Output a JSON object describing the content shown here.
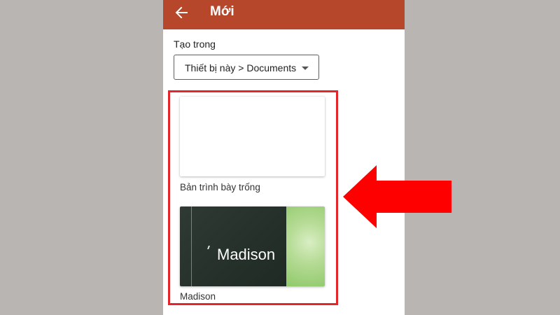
{
  "appbar": {
    "title": "Mới",
    "back_icon": "arrow-left-icon",
    "color": "#b7472a"
  },
  "create_in": {
    "label": "Tạo trong",
    "location_value": "Thiết bị này > Documents"
  },
  "templates": [
    {
      "name": "Bản trình bày trống",
      "thumbnail_title": ""
    },
    {
      "name": "Madison",
      "thumbnail_title": "Madison"
    }
  ],
  "annotation": {
    "highlight_color": "#e2262b",
    "arrow_color": "#ff0000",
    "arrow_icon": "arrow-left-icon"
  }
}
